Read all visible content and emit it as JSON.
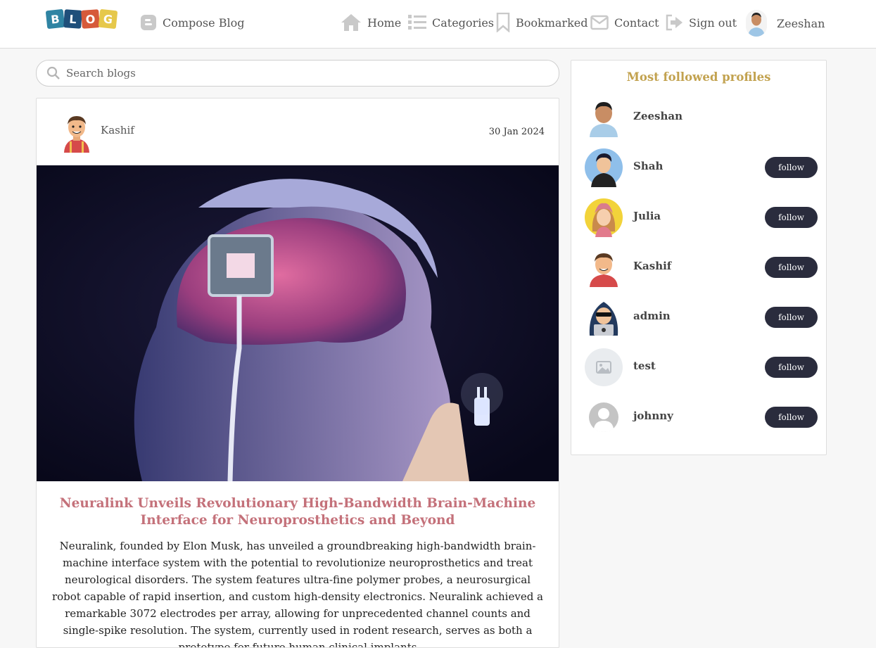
{
  "logo": {
    "letters": [
      "B",
      "L",
      "O",
      "G"
    ],
    "colors": [
      "#2f84a3",
      "#1f4f7a",
      "#d65a3a",
      "#e6c84b"
    ]
  },
  "nav": {
    "compose_label": "Compose Blog",
    "home_label": "Home",
    "categories_label": "Categories",
    "bookmarked_label": "Bookmarked",
    "contact_label": "Contact",
    "signout_label": "Sign out",
    "user_name": "Zeeshan"
  },
  "search": {
    "placeholder": "Search blogs",
    "value": ""
  },
  "post": {
    "author": "Kashif",
    "date": "30 Jan 2024",
    "title": "Neuralink Unveils Revolutionary High-Bandwidth Brain-Machine Interface for Neuroprosthetics and Beyond",
    "body": "Neuralink, founded by Elon Musk, has unveiled a groundbreaking high-bandwidth brain-machine interface system with the potential to revolutionize neuroprosthetics and treat neurological disorders. The system features ultra-fine polymer probes, a neurosurgical robot capable of rapid insertion, and custom high-density electronics. Neuralink achieved a remarkable 3072 electrodes per array, allowing for unprecedented channel counts and single-spike resolution. The system, currently used in rodent research, serves as both a prototype for future human clinical implants"
  },
  "sidebar": {
    "title": "Most followed profiles",
    "follow_label": "follow",
    "profiles": [
      {
        "name": "Zeeshan",
        "avatar": "man-photo-avatar",
        "followable": false
      },
      {
        "name": "Shah",
        "avatar": "hoodie-avatar",
        "followable": true
      },
      {
        "name": "Julia",
        "avatar": "girl-avatar",
        "followable": true
      },
      {
        "name": "Kashif",
        "avatar": "cartoon-man-avatar",
        "followable": true
      },
      {
        "name": "admin",
        "avatar": "hacker-avatar",
        "followable": true
      },
      {
        "name": "test",
        "avatar": "image-placeholder-avatar",
        "followable": true
      },
      {
        "name": "johnny",
        "avatar": "default-user-avatar",
        "followable": true
      }
    ]
  },
  "colors": {
    "accent_title": "#c4717a",
    "sidebar_title": "#c2a24f",
    "follow_button": "#2a2c3d"
  }
}
